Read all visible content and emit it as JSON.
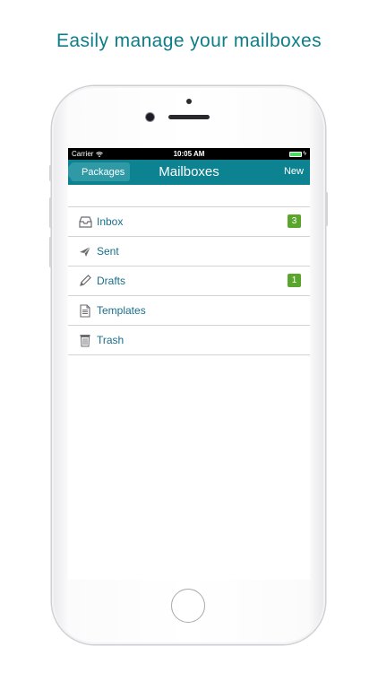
{
  "headline": "Easily manage your mailboxes",
  "status_bar": {
    "carrier": "Carrier",
    "time": "10:05 AM"
  },
  "nav": {
    "back_label": "Packages",
    "title": "Mailboxes",
    "action_label": "New"
  },
  "mailboxes": [
    {
      "label": "Inbox",
      "icon": "inbox-icon",
      "badge": "3"
    },
    {
      "label": "Sent",
      "icon": "paper-plane-icon",
      "badge": ""
    },
    {
      "label": "Drafts",
      "icon": "pencil-icon",
      "badge": "1"
    },
    {
      "label": "Templates",
      "icon": "document-icon",
      "badge": ""
    },
    {
      "label": "Trash",
      "icon": "trash-icon",
      "badge": ""
    }
  ],
  "colors": {
    "accent": "#0d8291",
    "headline": "#0d7d8a",
    "badge": "#5aa52c",
    "battery": "#4cd964"
  }
}
